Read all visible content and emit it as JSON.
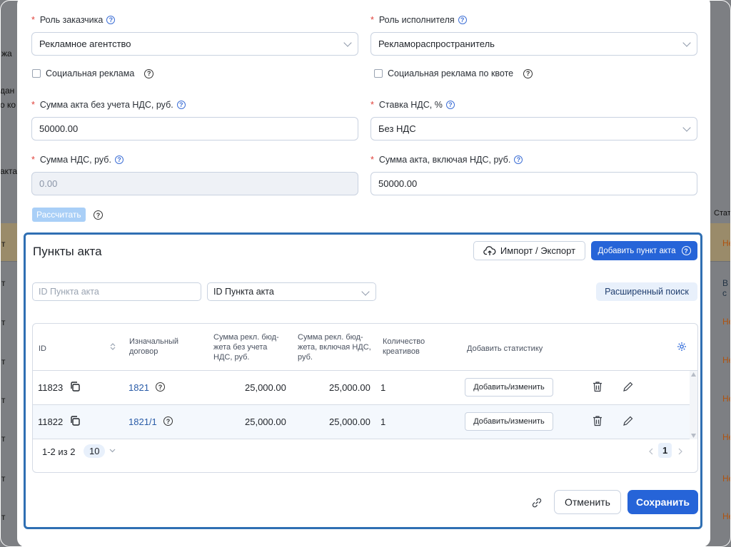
{
  "left": {
    "role_customer": {
      "label": "Роль заказчика",
      "value": "Рекламное агентство"
    },
    "social_ad": {
      "label": "Социальная реклама"
    },
    "sum_without_vat": {
      "label": "Сумма акта без учета НДС, руб.",
      "value": "50000.00"
    },
    "vat_sum": {
      "label": "Сумма НДС, руб.",
      "value": "0.00"
    },
    "calc_button": "Рассчитать"
  },
  "right": {
    "role_executor": {
      "label": "Роль исполнителя",
      "value": "Рекламораспространитель"
    },
    "social_ad_quota": {
      "label": "Социальная реклама по квоте"
    },
    "vat_rate": {
      "label": "Ставка НДС, %",
      "value": "Без НДС"
    },
    "sum_with_vat": {
      "label": "Сумма акта, включая НДС, руб.",
      "value": "50000.00"
    }
  },
  "section": {
    "title": "Пункты акта",
    "import_export": "Импорт / Экспорт",
    "add_item": "Добавить пункт акта",
    "search_placeholder": "ID Пункта акта",
    "filter_value": "ID Пункта акта",
    "advanced_search": "Расширенный поиск"
  },
  "table": {
    "headers": {
      "id": "ID",
      "contract_1": "Изначальный",
      "contract_2": "договор",
      "sum_no_vat_1": "Сумма рекл. бюд-",
      "sum_no_vat_2": "жета без учета",
      "sum_no_vat_3": "НДС, руб.",
      "sum_vat_1": "Сумма рекл. бюд-",
      "sum_vat_2": "жета, включая НДС,",
      "sum_vat_3": "руб.",
      "qty_1": "Количество",
      "qty_2": "креативов",
      "stats": "Добавить статистику"
    },
    "rows": [
      {
        "id": "11823",
        "contract": "1821",
        "sum_no_vat": "25,000.00",
        "sum_vat": "25,000.00",
        "qty": "1",
        "action": "Добавить/изменить"
      },
      {
        "id": "11822",
        "contract": "1821/1",
        "sum_no_vat": "25,000.00",
        "sum_vat": "25,000.00",
        "qty": "1",
        "action": "Добавить/изменить"
      }
    ],
    "pagination": {
      "range": "1-2 из 2",
      "per_page": "10",
      "page": "1"
    }
  },
  "footer": {
    "cancel": "Отменить",
    "save": "Сохранить"
  },
  "background": {
    "left_texts": [
      "жа",
      "дан",
      "о ко",
      "акта"
    ],
    "right_header": "Стат",
    "right_badges": [
      "Не",
      "В с",
      "Не",
      "Не",
      "Не",
      "Не",
      "Не",
      "Не"
    ],
    "left_cells": [
      "т",
      "т",
      "т",
      "т",
      "т",
      "т",
      "т",
      "т"
    ]
  },
  "colors": {
    "accent": "#2664d8",
    "section_border": "#2f6fb3",
    "required": "#e0413a"
  }
}
